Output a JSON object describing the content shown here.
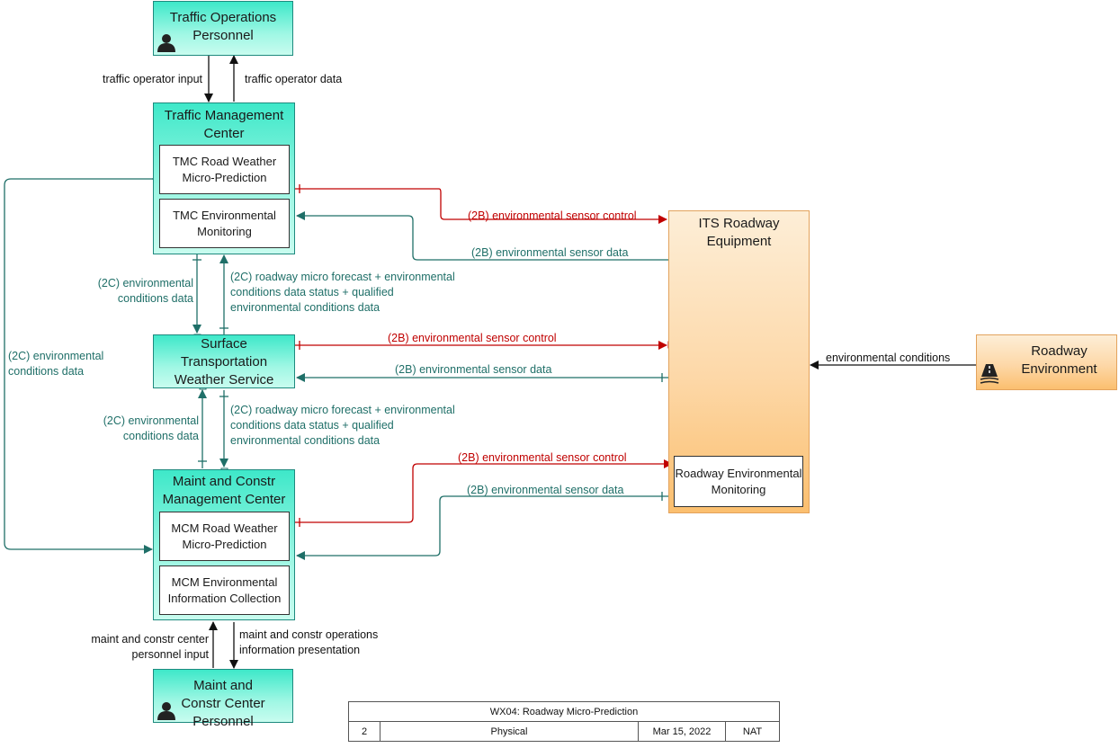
{
  "nodes": {
    "top": "Traffic Operations Personnel",
    "tmc": "Traffic Management Center",
    "tmc_sub1": "TMC Road Weather Micro-Prediction",
    "tmc_sub2": "TMC Environmental Monitoring",
    "stws": "Surface Transportation Weather Service",
    "mcm": "Maint and Constr Management Center",
    "mcm_sub1": "MCM Road Weather Micro-Prediction",
    "mcm_sub2": "MCM Environmental Information Collection",
    "bottom": "Maint and Constr Center Personnel",
    "its": "ITS Roadway Equipment",
    "its_sub": "Roadway Environmental Monitoring",
    "env": "Roadway Environment"
  },
  "flows": {
    "op_input": "traffic operator input",
    "op_data": "traffic operator data",
    "env_ctrl": "(2B) environmental sensor control",
    "env_data": "(2B) environmental sensor data",
    "cond_data": "(2C) environmental conditions data",
    "forecast": "(2C) roadway micro forecast + environmental conditions data status + qualified environmental conditions data",
    "env_conditions": "environmental conditions",
    "mcm_input": "maint and constr center personnel input",
    "mcm_pres": "maint and constr operations information presentation"
  },
  "footer": {
    "title": "WX04: Roadway Micro-Prediction",
    "page": "2",
    "view": "Physical",
    "date": "Mar 15, 2022",
    "org": "NAT"
  },
  "colors": {
    "green_flow": "#1f6f68",
    "red_flow": "#c00000",
    "black_flow": "#111111",
    "node_fill": "#6ff0d6",
    "its_fill": "#fdd8a8"
  }
}
